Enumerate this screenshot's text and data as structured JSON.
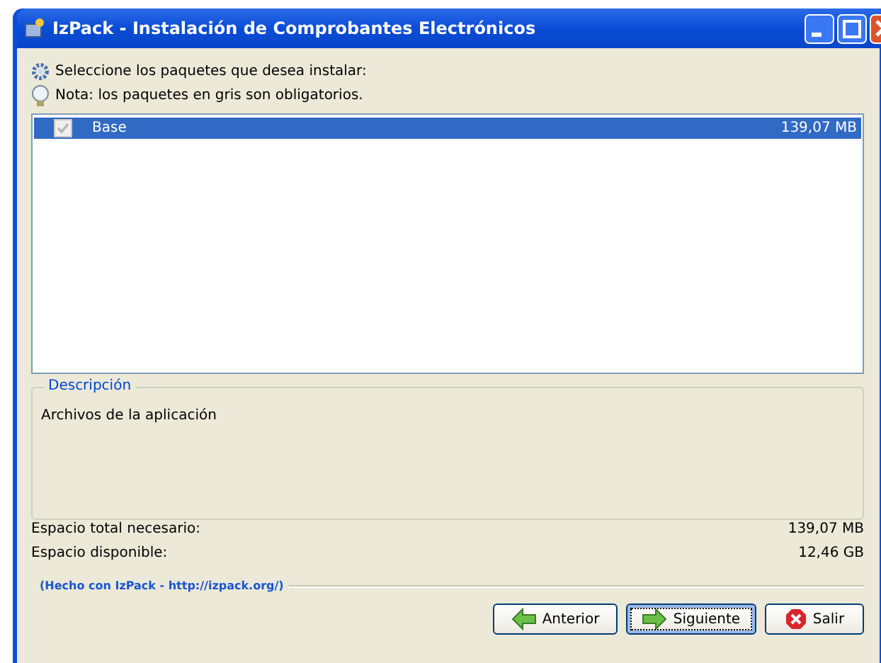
{
  "window": {
    "title": "IzPack - Instalación de Comprobantes Electrónicos"
  },
  "notes": [
    {
      "kind": "gear",
      "text": "Seleccione los paquetes que desea instalar:"
    },
    {
      "kind": "bulb",
      "text": "Nota: los paquetes en gris son obligatorios."
    }
  ],
  "packages": [
    {
      "name": "Base",
      "size": "139,07 MB",
      "checked": true,
      "disabled": true,
      "selected": true
    }
  ],
  "description": {
    "legend": "Descripción",
    "text": "Archivos de la aplicación"
  },
  "space": [
    {
      "label": "Espacio total necesario:",
      "value": "139,07 MB"
    },
    {
      "label": "Espacio disponible:",
      "value": "12,46 GB"
    }
  ],
  "credit": "(Hecho con IzPack - http://izpack.org/)",
  "buttons": [
    {
      "label": "Anterior",
      "kind": "back",
      "focused": false
    },
    {
      "label": "Siguiente",
      "kind": "next",
      "focused": true
    },
    {
      "label": "Salir",
      "kind": "quit",
      "focused": false
    }
  ]
}
